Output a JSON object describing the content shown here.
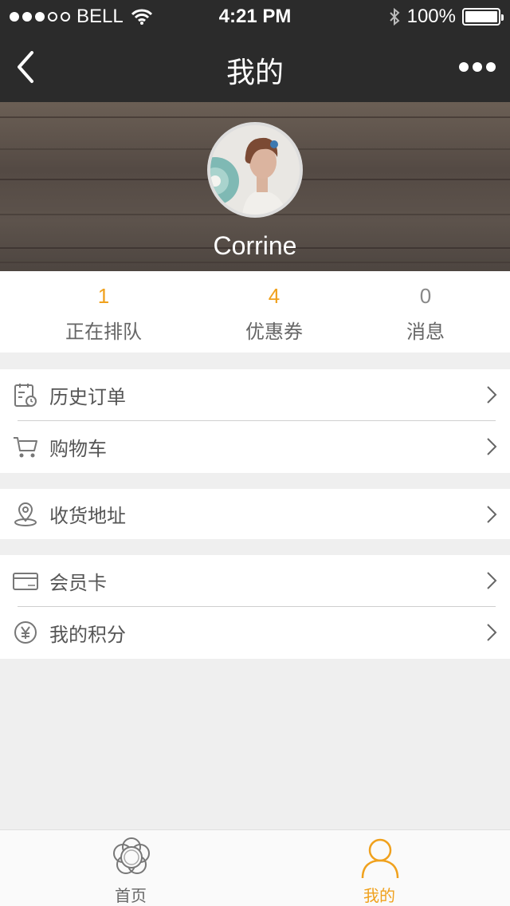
{
  "status_bar": {
    "carrier": "BELL",
    "time": "4:21 PM",
    "battery": "100%",
    "signal_bars": 3,
    "signal_total": 5
  },
  "nav": {
    "title": "我的"
  },
  "profile": {
    "name": "Corrine"
  },
  "stats": [
    {
      "value": "1",
      "label": "正在排队",
      "color": "#f0a11d"
    },
    {
      "value": "4",
      "label": "优惠券",
      "color": "#f0a11d"
    },
    {
      "value": "0",
      "label": "消息",
      "color": "#888888"
    }
  ],
  "menu_groups": [
    [
      {
        "label": "历史订单",
        "icon": "order-history-icon"
      },
      {
        "label": "购物车",
        "icon": "cart-icon"
      }
    ],
    [
      {
        "label": "收货地址",
        "icon": "location-pin-icon"
      }
    ],
    [
      {
        "label": "会员卡",
        "icon": "vip-card-icon"
      },
      {
        "label": "我的积分",
        "icon": "yen-coin-icon"
      }
    ]
  ],
  "tabs": [
    {
      "label": "首页",
      "icon": "flower-home-icon",
      "active": false
    },
    {
      "label": "我的",
      "icon": "person-icon",
      "active": true
    }
  ],
  "colors": {
    "accent": "#f0a11d",
    "nav_bg": "#2b2b2b",
    "page_bg": "#efefef",
    "inactive_tab": "#666666"
  }
}
